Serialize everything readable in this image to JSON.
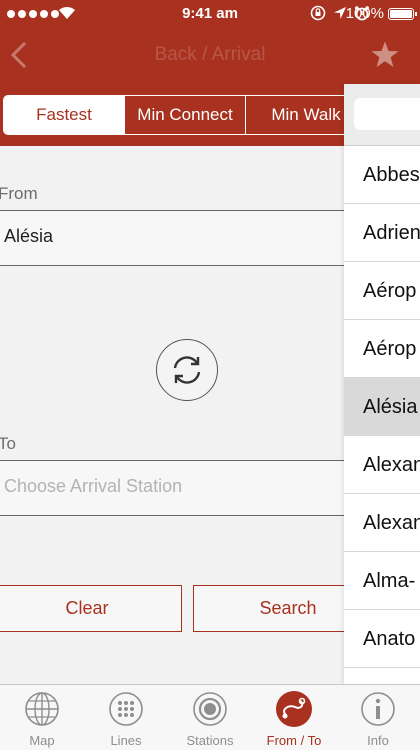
{
  "status": {
    "time": "9:41 am",
    "battery": "100%"
  },
  "nav": {
    "title": "Back / Arrival"
  },
  "segments": [
    "Fastest",
    "Min Connect",
    "Min Walk"
  ],
  "form": {
    "from_label": "From",
    "from_value": "Alésia",
    "to_label": "To",
    "to_placeholder": "Choose Arrival Station",
    "clear_label": "Clear",
    "search_label": "Search"
  },
  "stations": [
    "Abbes",
    "Adrien",
    "Aérop",
    "Aérop",
    "Alésia",
    "Alexan",
    "Alexan",
    "Alma-",
    "Anato"
  ],
  "tabs": [
    {
      "label": "Map",
      "icon": "globe-icon"
    },
    {
      "label": "Lines",
      "icon": "grid-dots-icon"
    },
    {
      "label": "Stations",
      "icon": "station-target-icon"
    },
    {
      "label": "From / To",
      "icon": "route-icon"
    },
    {
      "label": "Info",
      "icon": "info-icon"
    }
  ],
  "colors": {
    "accent": "#a8311f",
    "background": "#f2f2f2"
  }
}
